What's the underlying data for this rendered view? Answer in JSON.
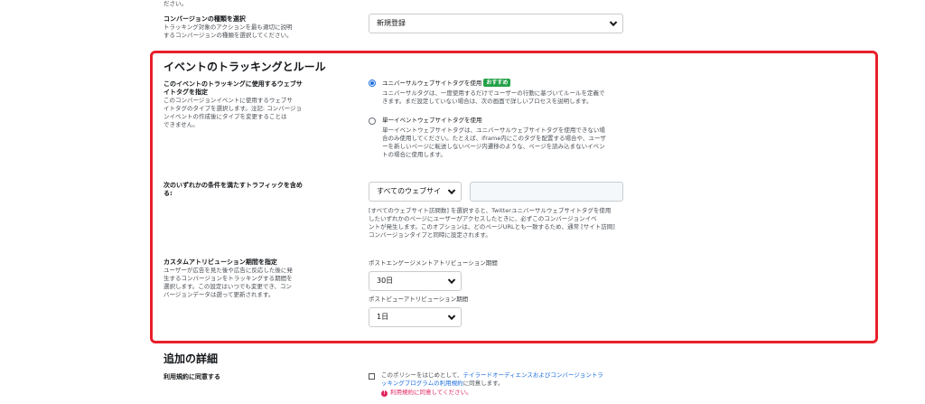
{
  "top_fragment": "ださい。",
  "conversion_type": {
    "label": "コンバージョンの種類を選択",
    "desc_1": "トラッキング対象のアクションを最も適切に説明",
    "desc_2": "するコンバージョンの種類を選択してください。",
    "selected": "新規登録"
  },
  "event_section": {
    "title": "イベントのトラッキングとルール",
    "tag": {
      "label_1": "このイベントのトラッキングに使用するウェブサ",
      "label_2": "イトタグを指定",
      "desc_1": "このコンバージョンイベントに使用するウェブサ",
      "desc_2": "イトタグのタイプを選択します。注記: コンバージョ",
      "desc_3": "ンイベントの作成後にタイプを変更することは",
      "desc_4": "できません。",
      "option_universal": {
        "label": "ユニバーサルウェブサイトタグを使用",
        "badge": "おすすめ",
        "desc_1": "ユニバーサルタグは、一度使用するだけでユーザーの行動に基づいてルールを定義で",
        "desc_2": "きます。まだ設定していない場合は、次の画面で詳しいプロセスを説明します。",
        "checked": true
      },
      "option_single": {
        "label": "単一イベントウェブサイトタグを使用",
        "desc_1": "単一イベントウェブサイトタグは、ユニバーサルウェブサイトタグを使用できない場",
        "desc_2": "合のみ使用してください。たとえば、iframe内にこのタグを配置する場合や、ユーザ",
        "desc_3": "ーを新しいページに転送しないページ内遷移のような、ページを読み込まないイベン",
        "desc_4": "トの場合に使用します。",
        "checked": false
      }
    },
    "traffic": {
      "label_1": "次のいずれかの条件を満たすトラフィックを含め",
      "label_2": "る:",
      "selected": "すべてのウェブサイ",
      "input_value": "",
      "help_1": "[すべてのウェブサイト訪問数] を選択すると、Twitterユニバーサルウェブサイトタグを使用",
      "help_2": "したいずれかのページにユーザーがアクセスしたときに、必ずこのコンバージョンイベ",
      "help_3": "ントが発生します。このオプションは、どのページURLとも一致するため、通常 [サイト訪問]",
      "help_4": "コンバージョンタイプと同時に設定されます。"
    },
    "attribution": {
      "label": "カスタムアトリビューション期間を指定",
      "desc_1": "ユーザーが広告を見た後や広告に反応した後に発",
      "desc_2": "生するコンバージョンをトラッキングする期間を",
      "desc_3": "選択します。この設定はいつでも変更でき、コン",
      "desc_4": "バージョンデータは遡って更新されます。",
      "post_engagement_label": "ポストエンゲージメントアトリビューション期間",
      "post_engagement_value": "30日",
      "post_view_label": "ポストビューアトリビューション期間",
      "post_view_value": "1日"
    }
  },
  "details_section": {
    "title": "追加の詳細",
    "terms_label": "利用規約に同意する",
    "terms_1_pre": "このポリシーをはじめとして、",
    "terms_1_link": "テイラードオーディエンスおよびコンバージョントラ",
    "terms_2_link": "ッキングプログラムの利用規約",
    "terms_2_post": "に同意します。",
    "error": "利用規約に同意してください。",
    "error_icon": "!"
  },
  "colors": {
    "highlight": "#e8202b",
    "accent": "#1d6fe0",
    "badge": "#24a148",
    "error": "#e0245e"
  }
}
